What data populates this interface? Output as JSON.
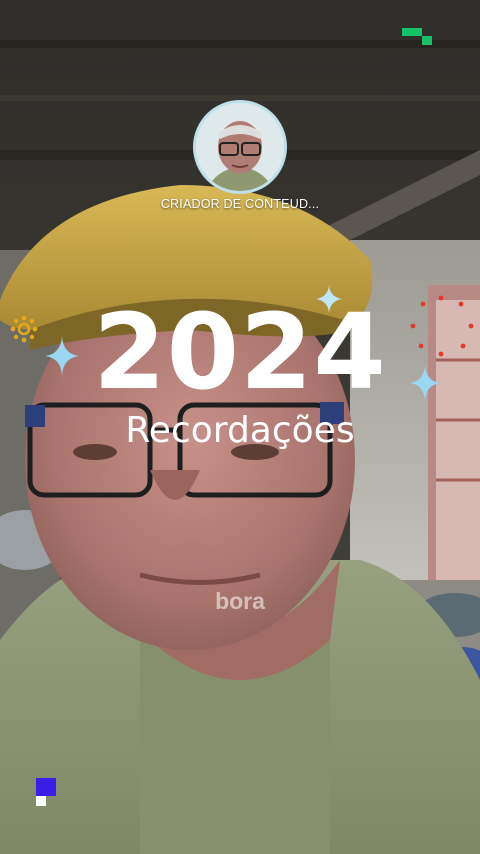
{
  "story": {
    "creator_label": "CRIADOR DE CONTEUD...",
    "year": "2024",
    "subtitle": "Recordações",
    "caption": "bora"
  },
  "colors": {
    "cap_yellow": "#d4b24a",
    "shirt_green": "#8d9973",
    "sparkle_blue": "#9ad7f3",
    "accent_green": "#18c26a",
    "accent_purple": "#3a1ee8",
    "dot_red": "#e43a2a",
    "sun_yellow": "#e6a81a"
  },
  "icons": [
    "sparkle-icon",
    "sun-icon",
    "green-pixel-icon",
    "purple-pixel-icon"
  ]
}
